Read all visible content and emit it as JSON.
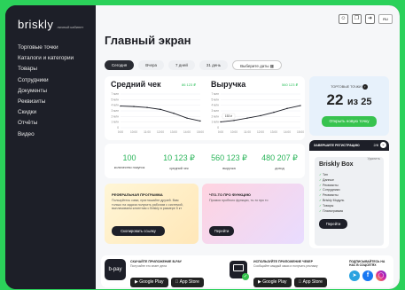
{
  "brand": {
    "logo": "briskly",
    "subtitle": "личный кабинет"
  },
  "sidebar": {
    "items": [
      "Торговые точки",
      "Каталоги и категории",
      "Товары",
      "Сотрудники",
      "Документы",
      "Реквизиты",
      "Скидки",
      "Отчёты",
      "Видео"
    ]
  },
  "header": {
    "title": "Главный экран",
    "lang": "RU"
  },
  "filters": {
    "items": [
      "Сегодня",
      "Вчера",
      "7 дней",
      "31 день",
      "Выберите даты"
    ],
    "active": "Сегодня"
  },
  "avg_check": {
    "title": "Средний чек",
    "change": "86 123 ₽"
  },
  "revenue": {
    "title": "Выручка",
    "change": "560 123 ₽",
    "tooltip": "153 ₽"
  },
  "chart_y_avg": [
    "7 млн",
    "5 млн",
    "4 млн",
    "3 млн",
    "2 млн",
    "1 млн",
    "0"
  ],
  "chart_y_rev": [
    "7 млн",
    "5 млн",
    "4 млн",
    "3 млн",
    "2 млн",
    "1 млн",
    "0"
  ],
  "chart_x": [
    "0:00",
    "10:00",
    "11:00",
    "12:00",
    "13:00",
    "14:00",
    "15:00"
  ],
  "stats": [
    {
      "value": "100",
      "label": "количество покупок"
    },
    {
      "value": "10 123 ₽",
      "label": "средний чек"
    },
    {
      "value": "560 123 ₽",
      "label": "выручка"
    },
    {
      "value": "480 207 ₽",
      "label": "доход"
    }
  ],
  "points": {
    "label": "ТОРГОВЫЕ ТОЧКИ",
    "count": "22",
    "of": "из 25",
    "button": "Открыть новую точку"
  },
  "registration": {
    "label": "ЗАВЕРШИТЕ РЕГИСТРАЦИЮ",
    "progress": "2/8",
    "title": "Briskly Box",
    "delete": "Удалить",
    "steps": [
      "Тип",
      "Данные",
      "Реквизиты",
      "Сотрудники",
      "Реквизиты",
      "Briskly Модуль",
      "Товары",
      "Планограмма"
    ],
    "button": "Перейти"
  },
  "referral": {
    "title": "РЕФЕРАЛЬНАЯ ПРОГРАММА",
    "text": "Пользуйтесь сами, приглашайте друзей. Вам только на задача получить рабочим с системой, выплачиваем клиентам с Briskly в размере 5 кт",
    "button": "Скопировать ссылку"
  },
  "new_features": {
    "title": "ЧТО-ТО ПРО ФУНКЦИЮ",
    "text": "Промоя пробного функции, то-то про то",
    "button": "Перейти"
  },
  "apps": [
    {
      "logo": "b-pay",
      "title": "СКАЧАЙТЕ ПРИЛОЖЕНИЕ B-PAY",
      "text": "Получайте это знает дела",
      "google": "Google Play",
      "apple": "App Store"
    },
    {
      "title": "ИСПОЛЬЗУЙТЕ ПРИЛОЖЕНИЕ ЧЕКЕР",
      "text": "Сообщайте каждый заказ и получать рекламу",
      "google": "Google Play",
      "apple": "App Store"
    }
  ],
  "social": {
    "title": "ПОДПИСЫВАЙТЕСЬ НА НАС В СОЦСЕТЯХ"
  },
  "colors": {
    "accent": "#37c34f",
    "sidebar": "#1d1f28",
    "frame": "#2bd15a"
  },
  "chart_data": [
    {
      "type": "line",
      "title": "Средний чек",
      "x": [
        "0:00",
        "10:00",
        "11:00",
        "12:00",
        "13:00",
        "14:00",
        "15:00"
      ],
      "values": [
        4.5,
        4.4,
        4.2,
        3.8,
        3.0,
        2.0,
        1.4
      ],
      "ylim": [
        0,
        7
      ]
    },
    {
      "type": "line",
      "title": "Выручка",
      "x": [
        "0:00",
        "10:00",
        "11:00",
        "12:00",
        "13:00",
        "14:00",
        "15:00"
      ],
      "values": [
        1.2,
        1.5,
        2.0,
        2.5,
        3.2,
        4.0,
        4.6
      ],
      "ylim": [
        0,
        7
      ]
    }
  ]
}
